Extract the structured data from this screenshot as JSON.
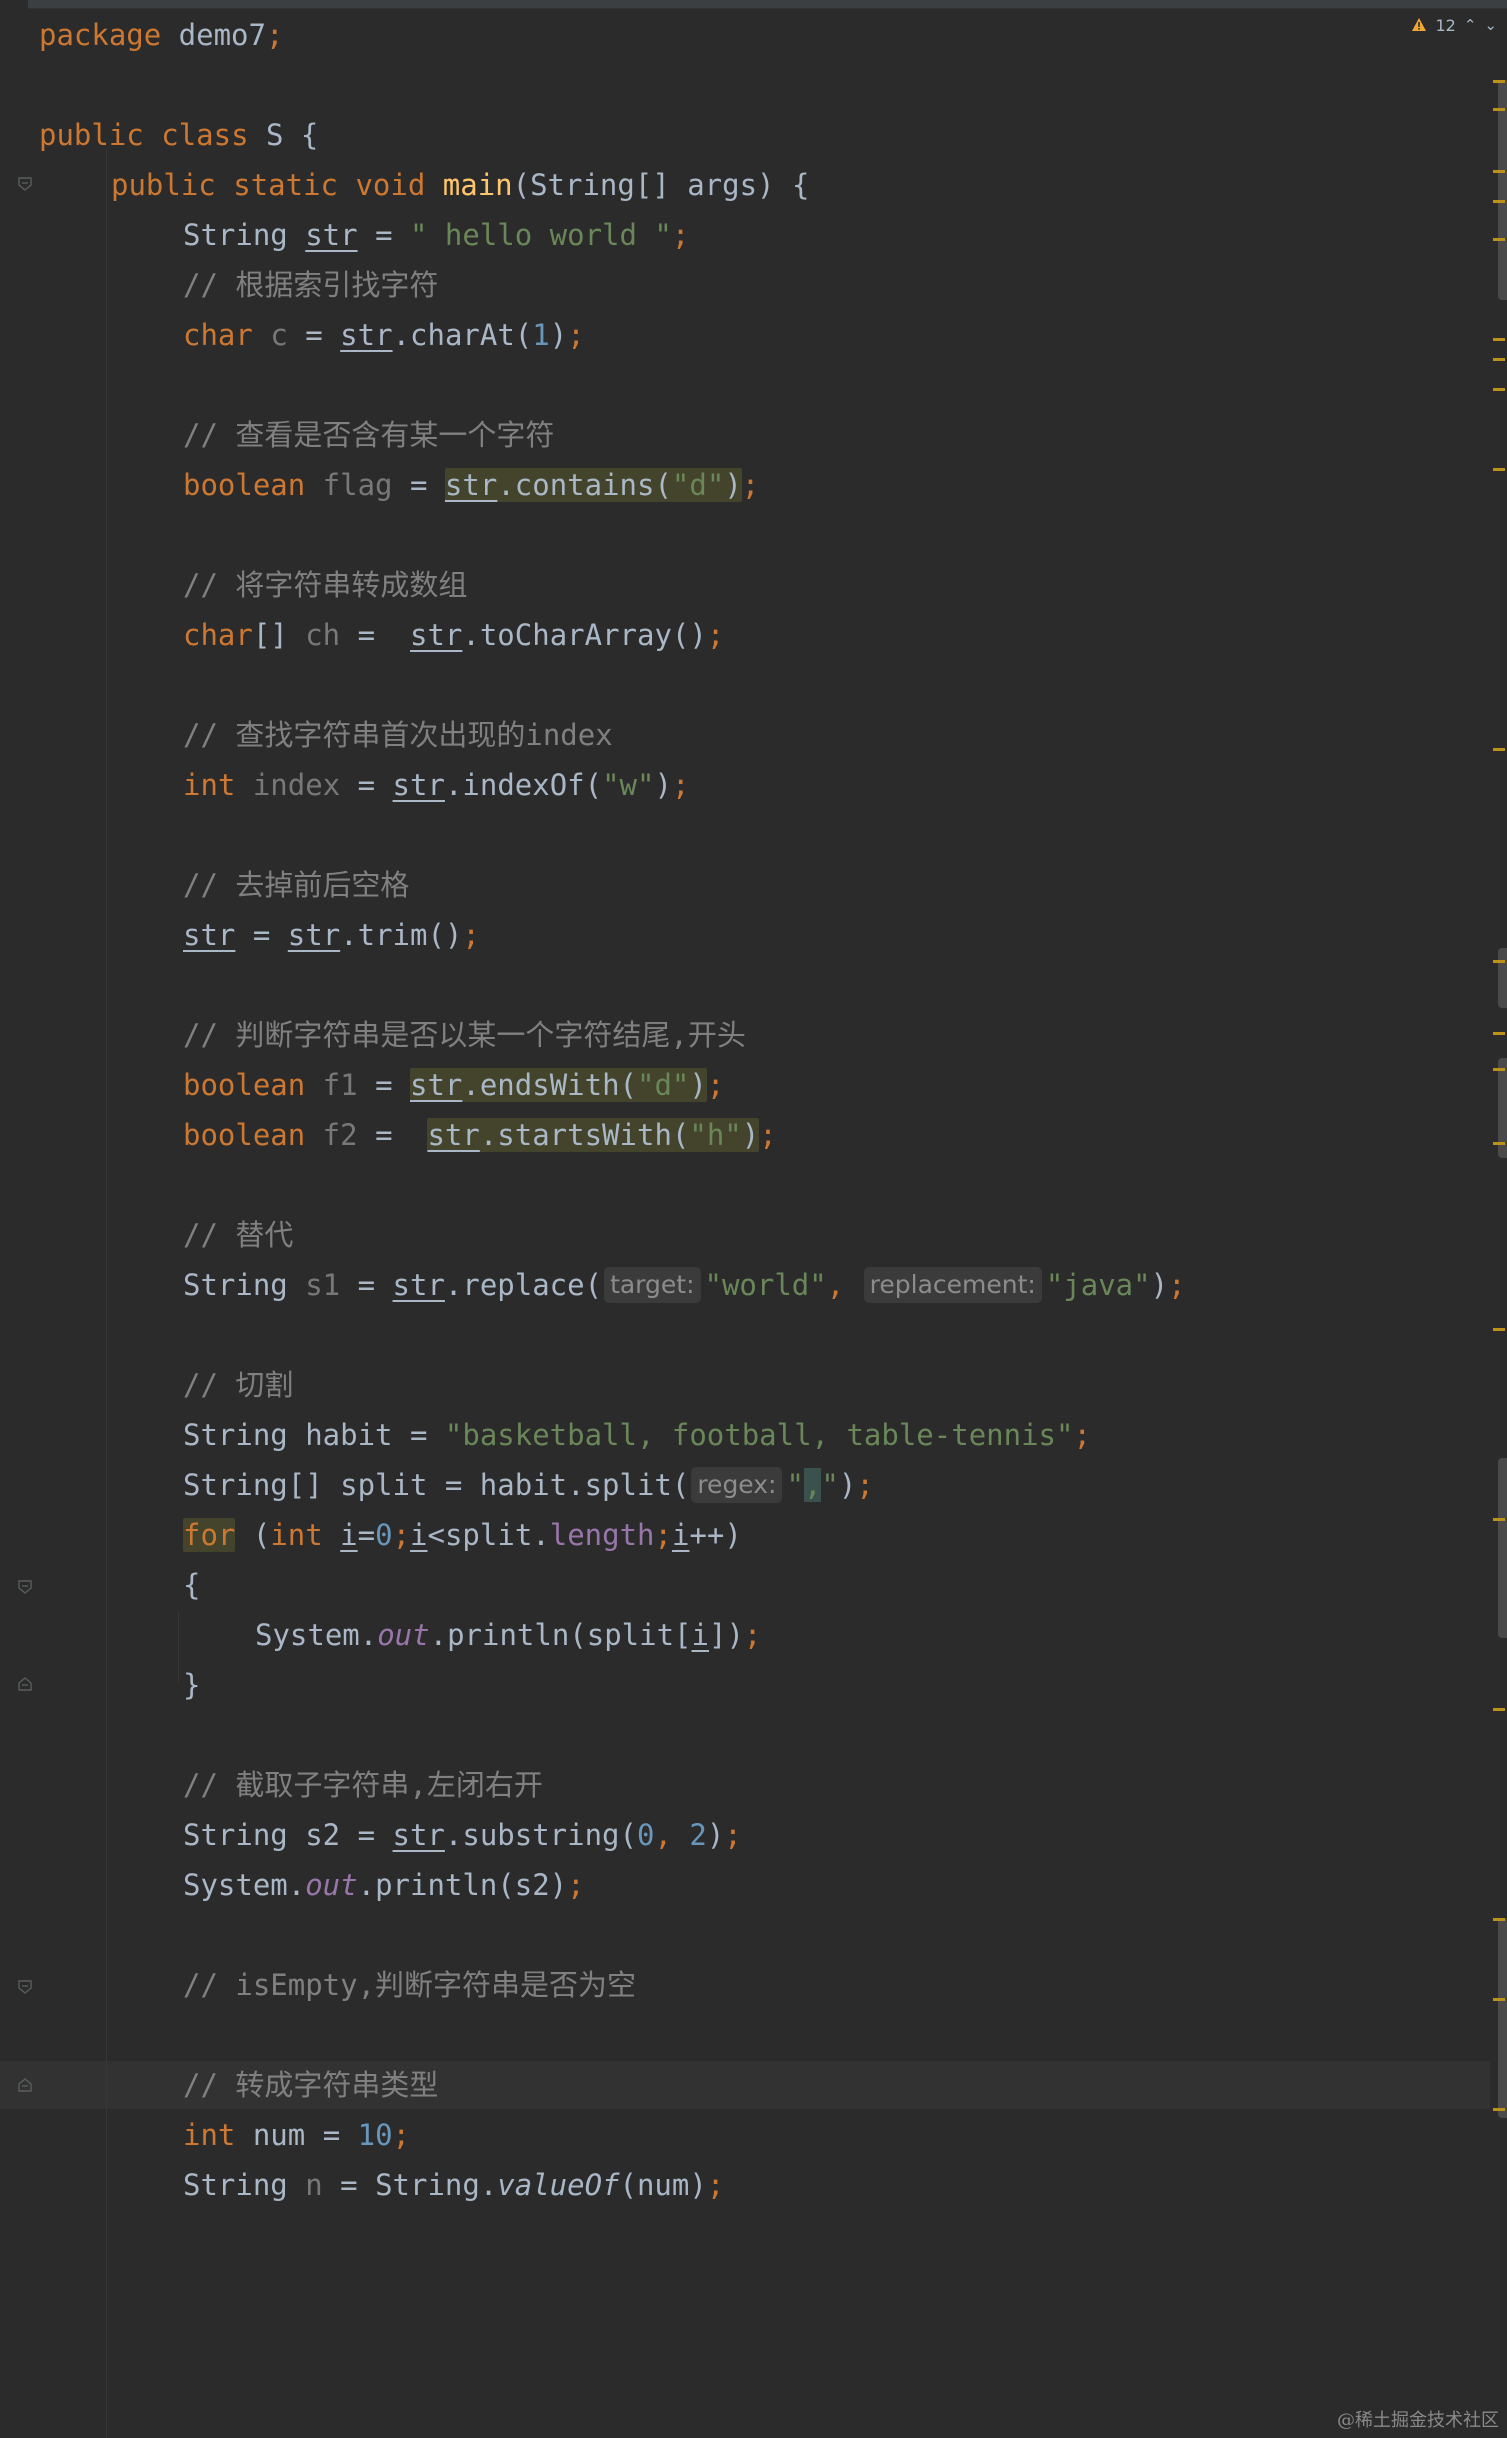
{
  "inspection": {
    "warning_count": "12",
    "prev_icon": "chevron-up-icon",
    "next_icon": "chevron-down-icon"
  },
  "code": {
    "package_kw": "package",
    "package_name": " demo7",
    "public_kw": "public",
    "class_kw": "class",
    "class_name": " S {",
    "static_kw": "static",
    "void_kw": "void",
    "main_name": "main",
    "main_params": "(String[] args) {",
    "str_decl_type": "String ",
    "str_var": "str",
    "str_literal": "\" hello world \"",
    "c_comment_index": "// 根据索引找字符",
    "char_kw": "char",
    "charat_call": ".charAt(",
    "charat_arg": "1",
    "c_comment_contains": "// 查看是否含有某一个字符",
    "boolean_kw": "boolean",
    "flag_var": " flag",
    "contains_call": ".contains(",
    "contains_arg": "\"d\"",
    "c_comment_chararray": "// 将字符串转成数组",
    "char_array_kw": "char",
    "ch_var": " ch",
    "tochararray_call": ".toCharArray()",
    "c_comment_indexof": "// 查找字符串首次出现的index",
    "int_kw": "int",
    "index_var": " index",
    "indexof_call": ".indexOf(",
    "indexof_arg": "\"w\"",
    "c_comment_trim": "// 去掉前后空格",
    "trim_call": ".trim()",
    "c_comment_endswith": "// 判断字符串是否以某一个字符结尾,开头",
    "f1_var": " f1",
    "endswith_call": ".endsWith(",
    "endswith_arg": "\"d\"",
    "f2_var": " f2",
    "startswith_call": ".startsWith(",
    "startswith_arg": "\"h\"",
    "c_comment_replace": "// 替代",
    "s1_var": "s1",
    "replace_call": ".replace(",
    "hint_target": "target:",
    "replace_arg1": "\"world\"",
    "hint_replacement": "replacement:",
    "replace_arg2": "\"java\"",
    "c_comment_split": "// 切割",
    "habit_decl": "String habit = ",
    "habit_literal": "\"basketball, football, table-tennis\"",
    "split_decl": "String[] split = habit.split(",
    "hint_regex": "regex:",
    "split_arg_q1": "\"",
    "split_arg_comma": ",",
    "split_arg_q2": "\"",
    "for_kw": "for",
    "for_open": " (",
    "for_int_kw": "int",
    "loop_var": "i",
    "for_zero": "0",
    "for_cond": "<split.",
    "length_field": "length",
    "for_inc": "++)",
    "open_brace": "{",
    "system_name": "System.",
    "out_field": "out",
    "println_split": ".println(split[",
    "println_split_end": "])",
    "close_brace": "}",
    "c_comment_substring": "// 截取子字符串,左闭右开",
    "s2_decl": "String s2 = ",
    "substring_call": ".substring(",
    "sub_arg1": "0",
    "sub_arg2": "2",
    "println_s2": ".println(s2)",
    "c_comment_isempty": "// isEmpty,判断字符串是否为空",
    "c_comment_valueof": "// 转成字符串类型",
    "num_decl": " num = ",
    "num_value": "10",
    "n_decl_type": "String ",
    "n_var": "n",
    "valueof_prefix": " = String.",
    "valueof_name": "valueOf",
    "valueof_args": "(num)"
  },
  "watermark": "@稀土掘金技术社区"
}
